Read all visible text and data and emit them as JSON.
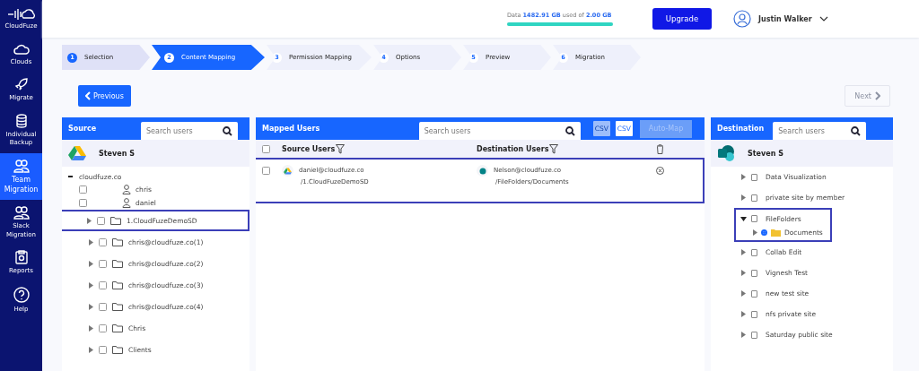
{
  "sidebar": {
    "brand": "CloudFuze",
    "items": [
      {
        "label": "Clouds",
        "kind": "cloud",
        "selected": false
      },
      {
        "label": "Migrate",
        "kind": "rocket",
        "selected": false
      },
      {
        "label": "Individual Backup",
        "kind": "database",
        "selected": false
      },
      {
        "label": "Team Migration",
        "kind": "users",
        "selected": true
      },
      {
        "label": "Slack Migration",
        "kind": "users",
        "selected": false
      },
      {
        "label": "Reports",
        "kind": "report",
        "selected": false
      },
      {
        "label": "Help",
        "kind": "help",
        "selected": false
      }
    ]
  },
  "header": {
    "usage": {
      "text": "Data **1482.91 GB** used of **2.00 GB**",
      "level": 1
    },
    "upgrade": "Upgrade",
    "user": "Justin Walker"
  },
  "steps": [
    {
      "number": "1",
      "label": "Selection",
      "selected": false,
      "completed": true
    },
    {
      "number": "2",
      "label": "Content Mapping",
      "selected": true,
      "completed": false
    },
    {
      "number": "3",
      "label": "Permission Mapping",
      "selected": false,
      "completed": false
    },
    {
      "number": "4",
      "label": "Options",
      "selected": false,
      "completed": false
    },
    {
      "number": "5",
      "label": "Preview",
      "selected": false,
      "completed": false
    },
    {
      "number": "6",
      "label": "Migration",
      "selected": false,
      "completed": false
    }
  ],
  "previous_button": "Previous",
  "next_button": {
    "label": "Next",
    "disabled": true
  },
  "source": {
    "title": "Source",
    "search": {
      "placeholder": "Search users"
    },
    "account": "Steven S",
    "domain": {
      "label": "cloudfuze.co",
      "expanded": true,
      "children": [
        {
          "label": "chris",
          "checked": false
        },
        {
          "label": "daniel",
          "checked": false
        }
      ]
    },
    "folders": [
      {
        "label": "1.CloudFuzeDemoSD",
        "checked": false,
        "selected": true
      },
      {
        "label": "chris@cloudfuze.co(1)",
        "checked": false,
        "selected": false
      },
      {
        "label": "chris@cloudfuze.co(2)",
        "checked": false,
        "selected": false
      },
      {
        "label": "chris@cloudfuze.co(3)",
        "checked": false,
        "selected": false
      },
      {
        "label": "chris@cloudfuze.co(4)",
        "checked": false,
        "selected": false
      },
      {
        "label": "Chris",
        "checked": false,
        "selected": false
      },
      {
        "label": "Clients",
        "checked": false,
        "selected": false
      }
    ]
  },
  "mapped": {
    "title": "Mapped Users",
    "search": {
      "placeholder": "Search users"
    },
    "csv_labels": [
      "CSV",
      "CSV"
    ],
    "select_all_checked": false,
    "auto_map": {
      "label": "Auto-Map",
      "disabled": true
    },
    "columns": [
      "Source Users",
      "Destination Users"
    ],
    "rows": [
      {
        "checked": false,
        "selected": true,
        "source_user": "daniel@cloudfuze.co",
        "source_path": "/1.CloudFuzeDemoSD",
        "destination_user": "Nelson@cloudfuze.co",
        "destination_path": "/FileFolders/Documents"
      }
    ]
  },
  "destination": {
    "title": "Destination",
    "search": {
      "placeholder": "Search users"
    },
    "account": "Steven S",
    "sites": [
      {
        "label": "Data Visualization",
        "expanded": false,
        "selected": false
      },
      {
        "label": "private site by member",
        "expanded": false,
        "selected": false
      },
      {
        "label": "FileFolders",
        "expanded": true,
        "selected": true,
        "children": [
          {
            "label": "Documents",
            "selected": true
          }
        ]
      },
      {
        "label": "Collab Edit",
        "expanded": false,
        "selected": false
      },
      {
        "label": "Vignesh Test",
        "expanded": false,
        "selected": false
      },
      {
        "label": "new test site",
        "expanded": false,
        "selected": false
      },
      {
        "label": "nfs private site",
        "expanded": false,
        "selected": false
      },
      {
        "label": "Saturday public site",
        "expanded": false,
        "selected": false
      }
    ]
  }
}
